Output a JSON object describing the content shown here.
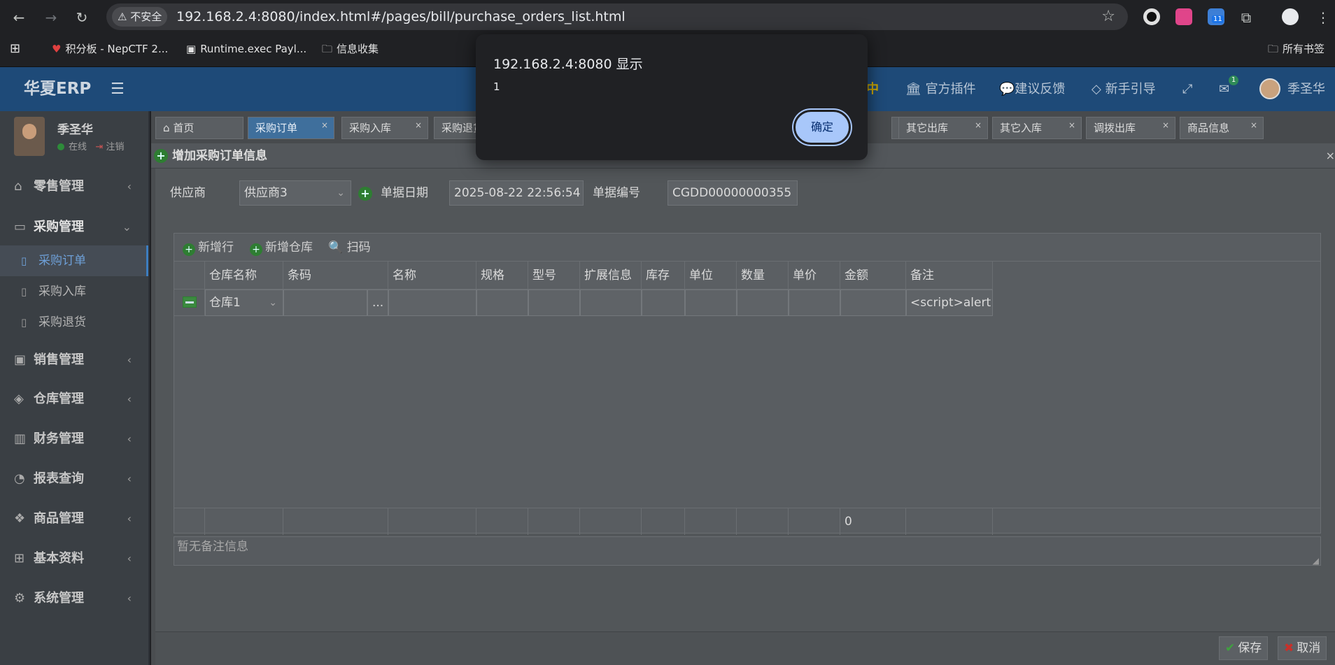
{
  "browser": {
    "insecure_label": "不安全",
    "url": "192.168.2.4:8080/index.html#/pages/bill/purchase_orders_list.html",
    "bookmarks": [
      "积分板 - NepCTF 2...",
      "Runtime.exec Payl...",
      "信息收集"
    ],
    "all_bookmarks": "所有书签",
    "extension_badge": "11"
  },
  "header": {
    "brand": "华夏ERP",
    "partial_item": "中",
    "items": [
      "官方插件",
      "建议反馈",
      "新手引导"
    ],
    "mail_badge": "1",
    "user": "季圣华"
  },
  "user_panel": {
    "name": "季圣华",
    "status": "在线",
    "logout": "注销"
  },
  "sidebar": {
    "menus": [
      {
        "label": "零售管理",
        "icon": "retail-icon"
      },
      {
        "label": "采购管理",
        "icon": "purchase-icon"
      },
      {
        "label": "销售管理",
        "icon": "sales-icon"
      },
      {
        "label": "仓库管理",
        "icon": "warehouse-icon"
      },
      {
        "label": "财务管理",
        "icon": "finance-icon"
      },
      {
        "label": "报表查询",
        "icon": "report-icon"
      },
      {
        "label": "商品管理",
        "icon": "goods-icon"
      },
      {
        "label": "基本资料",
        "icon": "basic-icon"
      },
      {
        "label": "系统管理",
        "icon": "system-icon"
      }
    ],
    "sub_items": [
      "采购订单",
      "采购入库",
      "采购退货"
    ]
  },
  "tabs": [
    "首页",
    "采购订单",
    "采购入库",
    "采购退货",
    "其它出库",
    "其它入库",
    "调拨出库",
    "商品信息"
  ],
  "panel": {
    "title": "增加采购订单信息"
  },
  "form": {
    "supplier_label": "供应商",
    "supplier_value": "供应商3",
    "date_label": "单据日期",
    "date_value": "2025-08-22 22:56:54",
    "number_label": "单据编号",
    "number_value": "CGDD00000000355"
  },
  "grid": {
    "toolbar": [
      "新增行",
      "新增仓库",
      "扫码"
    ],
    "columns": [
      "仓库名称",
      "条码",
      "名称",
      "规格",
      "型号",
      "扩展信息",
      "库存",
      "单位",
      "数量",
      "单价",
      "金额",
      "备注"
    ],
    "row": {
      "warehouse": "仓库1",
      "barcode_button": "...",
      "remark": "<script>alert"
    },
    "footer_amount": "0"
  },
  "remark_placeholder": "暂无备注信息",
  "actions": {
    "save": "保存",
    "cancel": "取消"
  },
  "dialog": {
    "title": "192.168.2.4:8080 显示",
    "message": "1",
    "ok": "确定"
  },
  "colors": {
    "header_bg": "#1e4a78",
    "dialog_button": "#a8c7fa",
    "accent": "#3c7dc0"
  }
}
